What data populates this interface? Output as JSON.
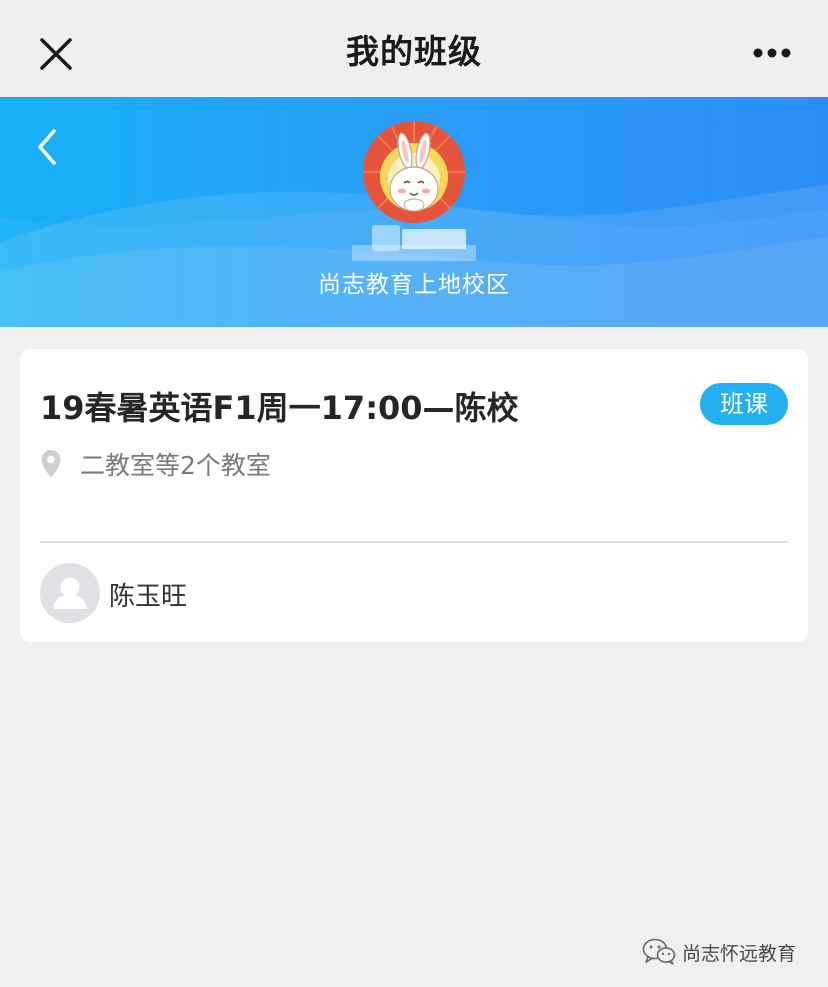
{
  "nav": {
    "title": "我的班级",
    "close_icon": "close-icon",
    "more_icon": "more-dots-icon"
  },
  "header": {
    "back_icon": "chevron-left-icon",
    "logo": "rabbit-logo",
    "school_name": "尚志教育上地校区"
  },
  "class_card": {
    "title": "19春暑英语F1周一17:00—陈校",
    "tag": "班课",
    "location_icon": "location-pin-icon",
    "location": "二教室等2个教室",
    "teacher": {
      "avatar_icon": "user-avatar-icon",
      "name": "陈玉旺"
    }
  },
  "watermark": {
    "icon": "wechat-icon",
    "text": "尚志怀远教育"
  },
  "colors": {
    "banner_start": "#17b0f5",
    "banner_end": "#2b8ef5",
    "tag_bg": "#22b0f0",
    "page_bg": "#f0f0f0"
  }
}
